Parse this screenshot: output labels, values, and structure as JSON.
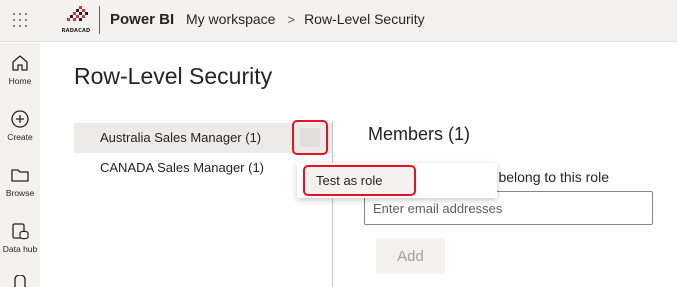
{
  "header": {
    "logo_text": "RADACAD",
    "product": "Power BI",
    "breadcrumb": [
      "My workspace",
      "Row-Level Security"
    ]
  },
  "nav": {
    "items": [
      {
        "label": "Home",
        "icon": "home-icon"
      },
      {
        "label": "Create",
        "icon": "create-icon"
      },
      {
        "label": "Browse",
        "icon": "folder-icon"
      },
      {
        "label": "Data hub",
        "icon": "data-hub-icon"
      },
      {
        "label": "",
        "icon": "metrics-icon"
      }
    ]
  },
  "page": {
    "title": "Row-Level Security"
  },
  "roles": [
    {
      "label": "Australia Sales Manager (1)",
      "selected": true
    },
    {
      "label": "CANADA Sales Manager (1)",
      "selected": false
    }
  ],
  "context_menu": {
    "items": [
      "Test as role"
    ]
  },
  "members": {
    "title": "Members (1)",
    "description": "ho belong to this role",
    "email_placeholder": "Enter email addresses",
    "add_label": "Add"
  },
  "colors": {
    "highlight_outline": "#e81123",
    "chrome_background": "#f3f2f1",
    "selected_role_background": "#edebe9"
  }
}
